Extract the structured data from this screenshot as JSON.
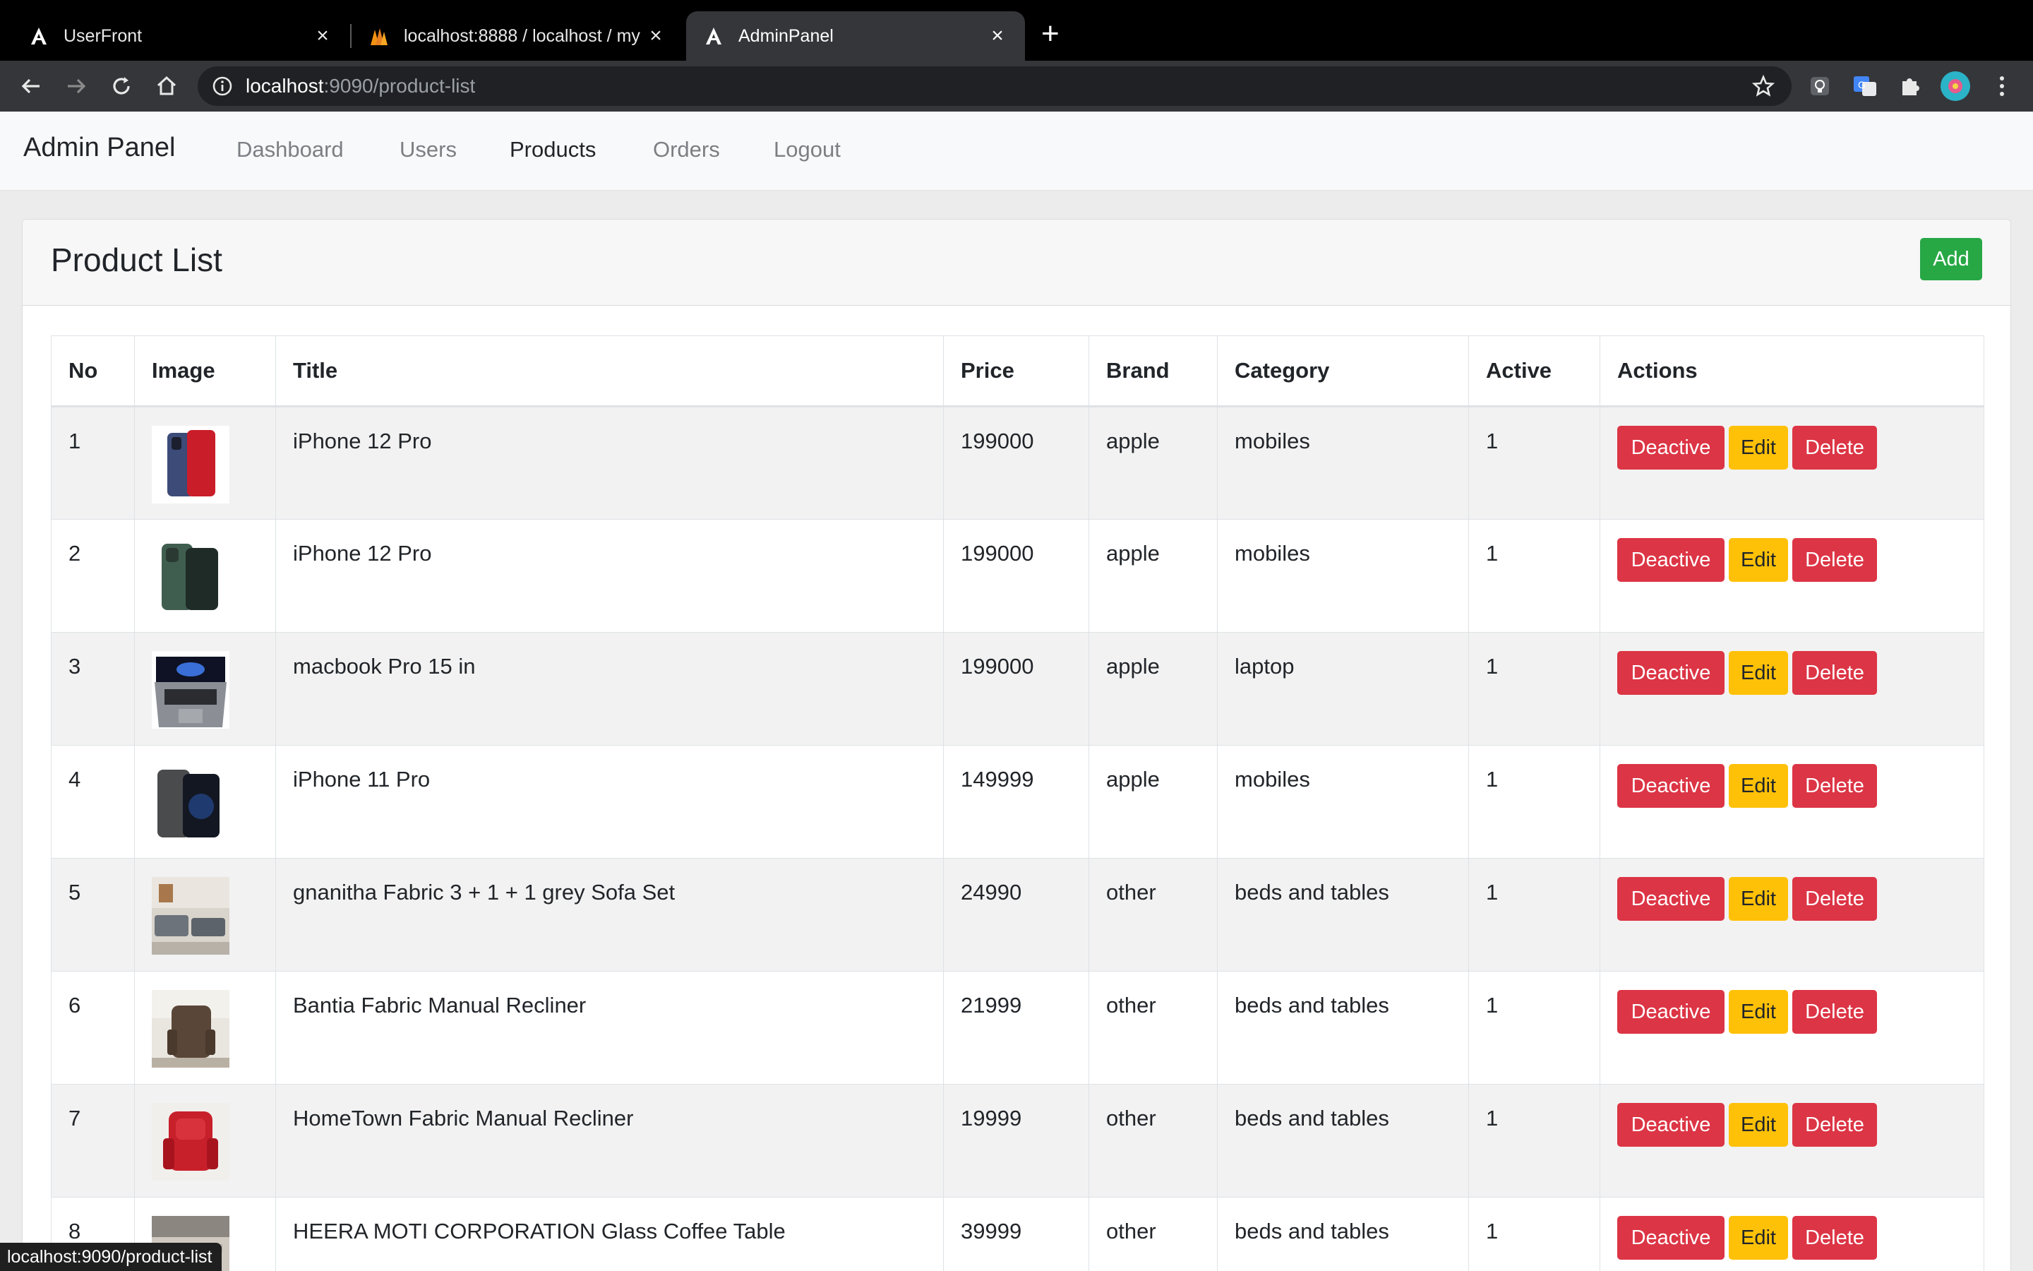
{
  "browser": {
    "tabs": [
      {
        "title": "UserFront",
        "favicon": "angular-icon"
      },
      {
        "title": "localhost:8888 / localhost / my",
        "favicon": "phpmyadmin-icon"
      },
      {
        "title": "AdminPanel",
        "favicon": "angular-icon",
        "active": true
      }
    ],
    "url_host": "localhost",
    "url_path": ":9090/product-list",
    "status_url": "localhost:9090/product-list"
  },
  "nav": {
    "brand": "Admin Panel",
    "links": [
      "Dashboard",
      "Users",
      "Products",
      "Orders",
      "Logout"
    ],
    "active": "Products"
  },
  "card": {
    "title": "Product List",
    "add_label": "Add"
  },
  "table": {
    "headers": [
      "No",
      "Image",
      "Title",
      "Price",
      "Brand",
      "Category",
      "Active",
      "Actions"
    ],
    "rows": [
      {
        "no": "1",
        "title": "iPhone 12 Pro",
        "price": "199000",
        "brand": "apple",
        "category": "mobiles",
        "active": "1",
        "image": "iphone-12-pro-blue"
      },
      {
        "no": "2",
        "title": "iPhone 12 Pro",
        "price": "199000",
        "brand": "apple",
        "category": "mobiles",
        "active": "1",
        "image": "iphone-green"
      },
      {
        "no": "3",
        "title": "macbook Pro 15 in",
        "price": "199000",
        "brand": "apple",
        "category": "laptop",
        "active": "1",
        "image": "macbook"
      },
      {
        "no": "4",
        "title": "iPhone 11 Pro",
        "price": "149999",
        "brand": "apple",
        "category": "mobiles",
        "active": "1",
        "image": "iphone-11-pro"
      },
      {
        "no": "5",
        "title": "gnanitha Fabric 3 + 1 + 1 grey Sofa Set",
        "price": "24990",
        "brand": "other",
        "category": "beds and tables",
        "active": "1",
        "image": "sofa-set"
      },
      {
        "no": "6",
        "title": "Bantia Fabric Manual Recliner",
        "price": "21999",
        "brand": "other",
        "category": "beds and tables",
        "active": "1",
        "image": "recliner-brown"
      },
      {
        "no": "7",
        "title": "HomeTown Fabric Manual Recliner",
        "price": "19999",
        "brand": "other",
        "category": "beds and tables",
        "active": "1",
        "image": "recliner-red"
      },
      {
        "no": "8",
        "title": "HEERA MOTI CORPORATION Glass Coffee Table",
        "price": "39999",
        "brand": "other",
        "category": "beds and tables",
        "active": "1",
        "image": "coffee-table"
      }
    ],
    "actions": {
      "deactive": "Deactive",
      "edit": "Edit",
      "delete": "Delete"
    }
  },
  "colors": {
    "success": "#28a745",
    "danger": "#dc3545",
    "warning": "#ffc107",
    "navbar_bg": "#f8f9fa"
  }
}
